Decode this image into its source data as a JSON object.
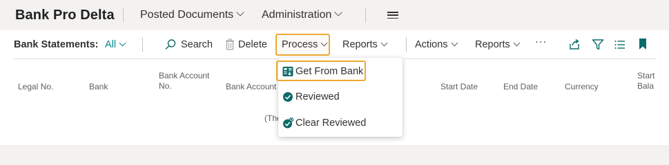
{
  "app": {
    "title": "Bank Pro Delta",
    "nav": [
      {
        "label": "Posted Documents"
      },
      {
        "label": "Administration"
      }
    ]
  },
  "action_bar": {
    "page_label": "Bank Statements:",
    "filter_value": "All",
    "search_label": "Search",
    "delete_label": "Delete",
    "process_label": "Process",
    "reports_label": "Reports",
    "actions_label": "Actions",
    "reports2_label": "Reports",
    "more_label": "···"
  },
  "table": {
    "columns": [
      {
        "label": "Legal No."
      },
      {
        "label": "Bank"
      },
      {
        "label": "Bank Account No."
      },
      {
        "label": "Bank Account"
      },
      {
        "label": "Start Date"
      },
      {
        "label": "End Date"
      },
      {
        "label": "Currency"
      },
      {
        "label": "Start Bala"
      }
    ],
    "empty_text": "(The"
  },
  "process_menu": {
    "items": [
      {
        "label": "Get From Bank",
        "icon": "get-from-bank-icon"
      },
      {
        "label": "Reviewed",
        "icon": "check-circle-icon"
      },
      {
        "label": "Clear Reviewed",
        "icon": "clear-check-icon"
      }
    ]
  },
  "colors": {
    "accent": "#008489",
    "highlight": "#f0a830",
    "icon": "#0f6a6a"
  }
}
